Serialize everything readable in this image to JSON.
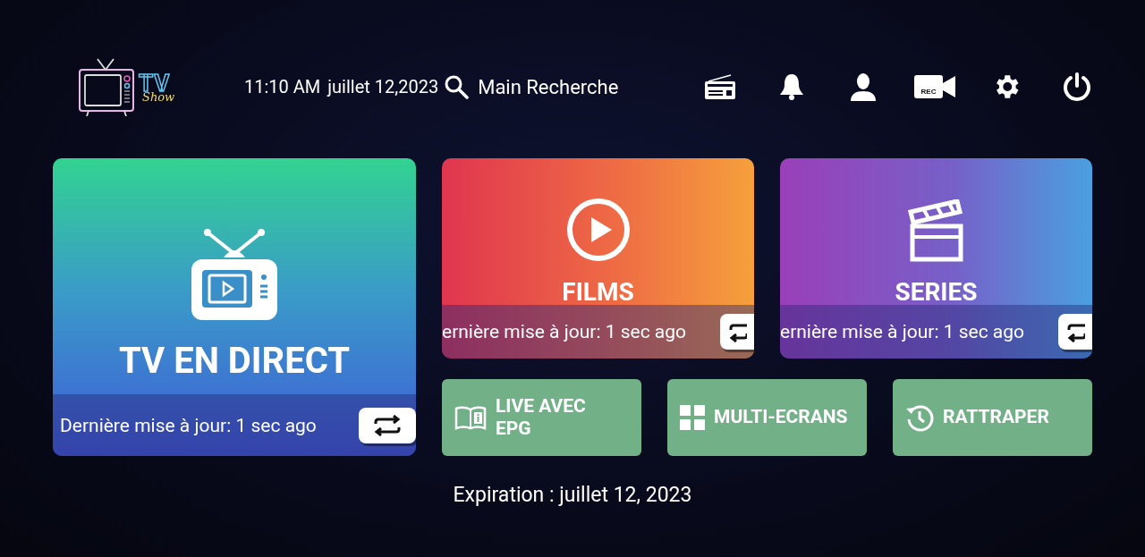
{
  "logo": {
    "title": "TV",
    "subtitle": "Show"
  },
  "header": {
    "time": "11:10 AM",
    "date": "juillet 12,2023",
    "search": "Main Recherche",
    "rec_label": "REC"
  },
  "main_tile": {
    "title": "TV EN DIRECT",
    "update": "Dernière mise à jour: 1 sec ago"
  },
  "tiles": [
    {
      "title": "FILMS",
      "update": "ernière mise à jour: 1 sec ago"
    },
    {
      "title": "SERIES",
      "update": "ernière mise à jour: 1 sec ago"
    }
  ],
  "buttons": [
    {
      "label": "LIVE AVEC EPG"
    },
    {
      "label": "MULTI-ECRANS"
    },
    {
      "label": "RATTRAPER"
    }
  ],
  "expiration": "Expiration : juillet 12, 2023"
}
